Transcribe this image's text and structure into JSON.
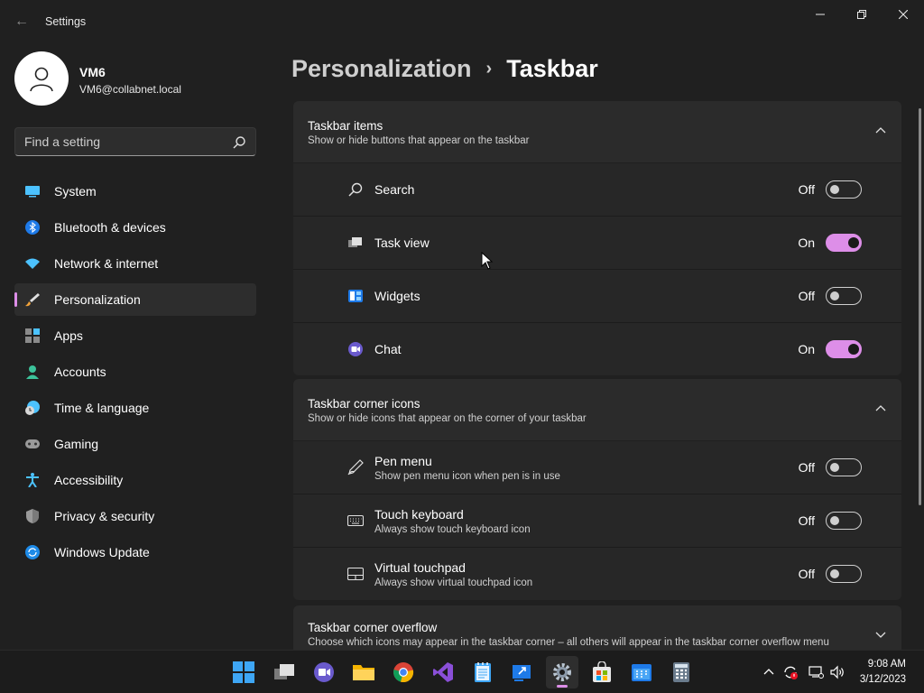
{
  "window": {
    "title": "Settings",
    "minimize_glyph": "—",
    "maximize_glyph": "❐",
    "close_glyph": "✕",
    "back_glyph": "←"
  },
  "user": {
    "name": "VM6",
    "email": "VM6@collabnet.local"
  },
  "search": {
    "placeholder": "Find a setting"
  },
  "sidebar": {
    "items": [
      {
        "label": "System",
        "icon": "monitor-icon"
      },
      {
        "label": "Bluetooth & devices",
        "icon": "bluetooth-icon"
      },
      {
        "label": "Network & internet",
        "icon": "wifi-icon"
      },
      {
        "label": "Personalization",
        "icon": "brush-icon",
        "selected": true
      },
      {
        "label": "Apps",
        "icon": "apps-icon"
      },
      {
        "label": "Accounts",
        "icon": "person-icon"
      },
      {
        "label": "Time & language",
        "icon": "clock-globe-icon"
      },
      {
        "label": "Gaming",
        "icon": "gamepad-icon"
      },
      {
        "label": "Accessibility",
        "icon": "accessibility-icon"
      },
      {
        "label": "Privacy & security",
        "icon": "shield-icon"
      },
      {
        "label": "Windows Update",
        "icon": "update-icon"
      }
    ]
  },
  "breadcrumb": {
    "parent": "Personalization",
    "separator": "›",
    "current": "Taskbar"
  },
  "taskbar_items": {
    "title": "Taskbar items",
    "subtitle": "Show or hide buttons that appear on the taskbar",
    "rows": [
      {
        "label": "Search",
        "state": "Off",
        "on": false
      },
      {
        "label": "Task view",
        "state": "On",
        "on": true
      },
      {
        "label": "Widgets",
        "state": "Off",
        "on": false
      },
      {
        "label": "Chat",
        "state": "On",
        "on": true
      }
    ]
  },
  "corner_icons": {
    "title": "Taskbar corner icons",
    "subtitle": "Show or hide icons that appear on the corner of your taskbar",
    "rows": [
      {
        "label": "Pen menu",
        "desc": "Show pen menu icon when pen is in use",
        "state": "Off",
        "on": false
      },
      {
        "label": "Touch keyboard",
        "desc": "Always show touch keyboard icon",
        "state": "Off",
        "on": false
      },
      {
        "label": "Virtual touchpad",
        "desc": "Always show virtual touchpad icon",
        "state": "Off",
        "on": false
      }
    ]
  },
  "corner_overflow": {
    "title": "Taskbar corner overflow",
    "subtitle": "Choose which icons may appear in the taskbar corner – all others will appear in the taskbar corner overflow menu"
  },
  "clock": {
    "time": "9:08 AM",
    "date": "3/12/2023"
  },
  "colors": {
    "accent": "#dd8ee8",
    "background": "#202020",
    "card": "#2b2b2b"
  }
}
